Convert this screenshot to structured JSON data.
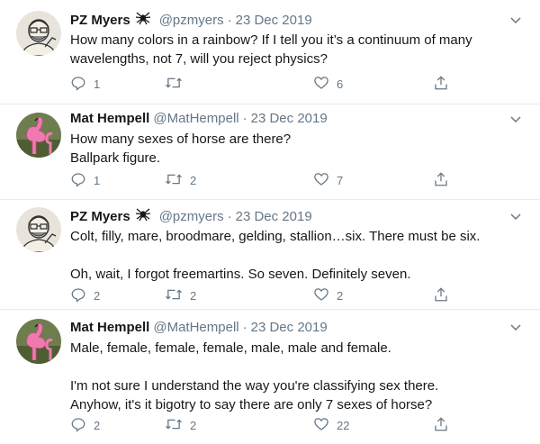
{
  "tweets": [
    {
      "author": "PZ Myers",
      "has_spider": true,
      "handle": "@pzmyers",
      "separator": "·",
      "date": "23 Dec 2019",
      "text": "How many colors in a rainbow? If I tell you it’s a continuum of many\nwavelengths, not 7, will you reject physics?",
      "replies": "1",
      "retweets": "",
      "likes": "6"
    },
    {
      "author": "Mat Hempell",
      "has_spider": false,
      "handle": "@MatHempell",
      "separator": "·",
      "date": "23 Dec 2019",
      "text": "How many sexes of horse are there?\nBallpark figure.",
      "replies": "1",
      "retweets": "2",
      "likes": "7"
    },
    {
      "author": "PZ Myers",
      "has_spider": true,
      "handle": "@pzmyers",
      "separator": "·",
      "date": "23 Dec 2019",
      "text": "Colt, filly, mare, broodmare, gelding, stallion…six. There must be six.\n\nOh, wait, I forgot freemartins. So seven. Definitely seven.",
      "replies": "2",
      "retweets": "2",
      "likes": "2"
    },
    {
      "author": "Mat Hempell",
      "has_spider": false,
      "handle": "@MatHempell",
      "separator": "·",
      "date": "23 Dec 2019",
      "text": "Male, female, female, female, male, male and female.\n\nI'm not sure I understand the way you're classifying sex there.\nAnyhow, it's it bigotry to say there are only 7 sexes of horse?",
      "replies": "2",
      "retweets": "2",
      "likes": "22"
    }
  ],
  "icons": {
    "reply": "reply-icon",
    "retweet": "retweet-icon",
    "like": "heart-icon",
    "share": "share-icon",
    "caret": "chevron-down-icon",
    "spider": "spider-icon"
  },
  "colors": {
    "text": "#14171a",
    "secondary": "#657786",
    "border": "#e6ecf0"
  }
}
